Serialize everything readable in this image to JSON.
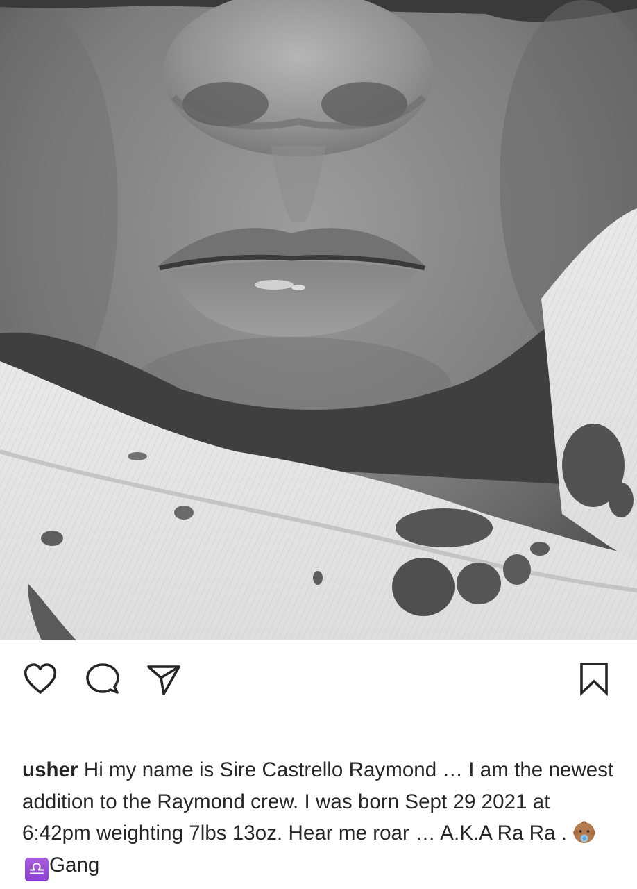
{
  "post": {
    "photo_icon": "newborn-face-closeup-image",
    "actions": {
      "like_icon": "heart-icon",
      "comment_icon": "comment-icon",
      "share_icon": "send-icon",
      "save_icon": "bookmark-icon"
    },
    "caption": {
      "username": "usher",
      "text_main": "Hi my name is Sire Castrello Raymond … I am the newest addition to the Raymond crew. I was born Sept 29 2021 at 6:42pm weighting 7lbs 13oz. Hear me roar … A.K.A Ra Ra .",
      "emoji_baby": "baby-emoji",
      "emoji_libra": "♎",
      "text_end": "Gang"
    },
    "colors": {
      "text": "#262626",
      "background": "#ffffff",
      "libra_purple": "#9a4fd8"
    }
  }
}
